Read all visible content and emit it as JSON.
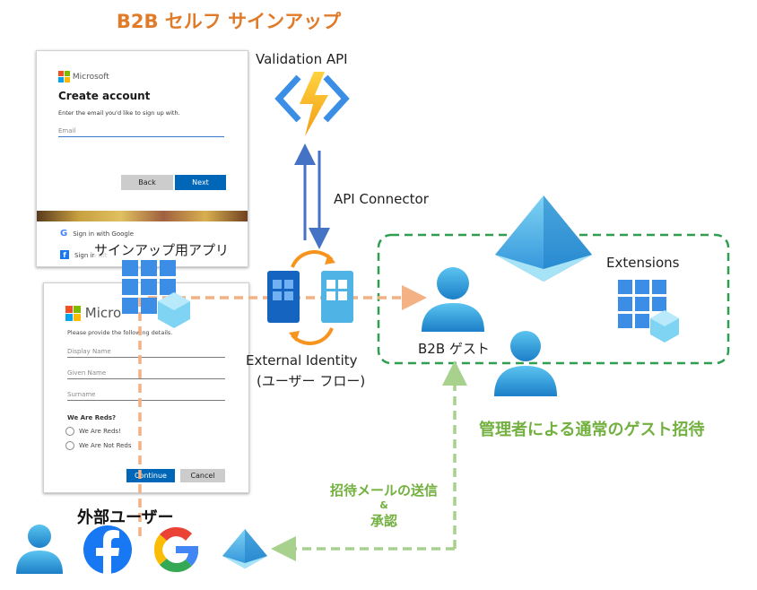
{
  "title": "B2B セルフ サインアップ",
  "signup_window_1": {
    "brand": "Microsoft",
    "heading": "Create account",
    "instruction": "Enter the email you'd like to sign up with.",
    "email_placeholder": "Email",
    "back_label": "Back",
    "next_label": "Next",
    "google_option": "Sign in with Google",
    "facebook_option": "Sign in wit"
  },
  "signup_window_2": {
    "brand": "Micro",
    "instruction": "Please provide the following details.",
    "fields": [
      "Display Name",
      "Given Name",
      "Surname"
    ],
    "question": "We Are Reds?",
    "options": [
      "We Are Reds!",
      "We Are Not Reds"
    ],
    "continue_label": "Continue",
    "cancel_label": "Cancel"
  },
  "labels": {
    "signup_app": "サインアップ用アプリ",
    "validation_api": "Validation API",
    "api_connector": "API Connector",
    "external_identity": "External Identity",
    "user_flow": "(ユーザー フロー)",
    "b2b_guest": "B2B ゲスト",
    "extensions": "Extensions",
    "admin_invite": "管理者による通常のゲスト招待",
    "invite_mail_1": "招待メールの送信",
    "invite_mail_amp": "&",
    "invite_mail_2": "承認",
    "external_users": "外部ユーザー"
  },
  "colors": {
    "title_orange": "#E07B2A",
    "flow_orange": "#F4B183",
    "green_dashed": "#2E9E4F",
    "green_arrow": "#A9D18E",
    "green_text": "#72B03F",
    "azure_blue": "#2F77D2",
    "api_arrow": "#4472C4"
  },
  "icons": [
    "azure-function-icon",
    "azure-ad-icon",
    "app-registration-icon",
    "user-flow-icon",
    "user-icon",
    "facebook-icon",
    "google-icon"
  ]
}
